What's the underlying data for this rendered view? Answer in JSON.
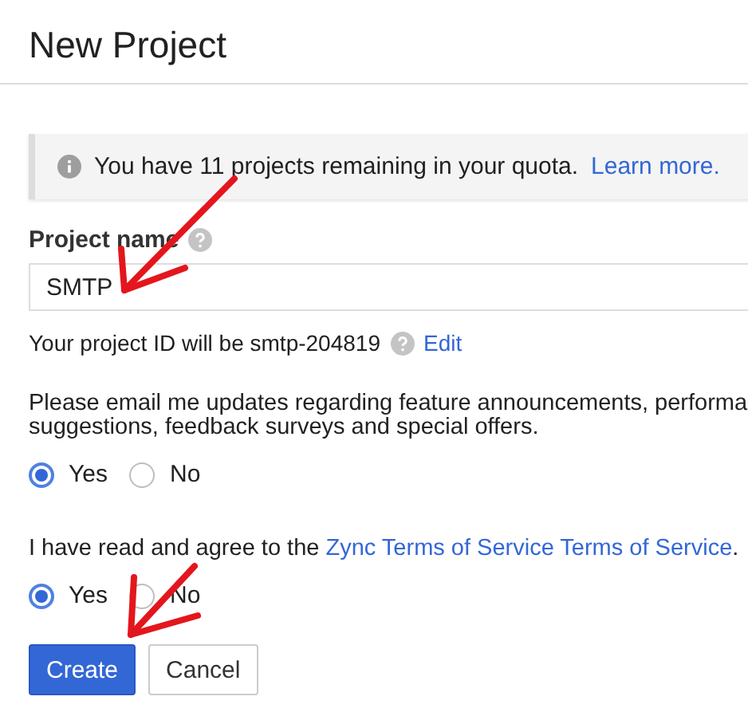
{
  "title": "New Project",
  "quota_notice": {
    "text": "You have 11 projects remaining in your quota.",
    "link": "Learn more."
  },
  "project_name": {
    "label": "Project name",
    "value": "SMTP"
  },
  "project_id": {
    "text": "Your project ID will be smtp-204819",
    "link": "Edit"
  },
  "email_updates": {
    "lines": [
      "Please email me updates regarding feature announcements, performa",
      "suggestions, feedback surveys and special offers."
    ],
    "options": [
      {
        "label": "Yes",
        "selected": true
      },
      {
        "label": "No",
        "selected": false
      }
    ]
  },
  "terms": {
    "text": "I have read and agree to the",
    "link": "Zync Terms of Service Terms of Service",
    "end": ".",
    "options": [
      {
        "label": "Yes",
        "selected": true
      },
      {
        "label": "No",
        "selected": false
      }
    ]
  },
  "buttons": [
    {
      "label": "Create",
      "kind": "primary"
    },
    {
      "label": "Cancel",
      "kind": "secondary"
    }
  ],
  "annotations": [
    {
      "kind": "arrow"
    },
    {
      "kind": "arrow"
    }
  ]
}
